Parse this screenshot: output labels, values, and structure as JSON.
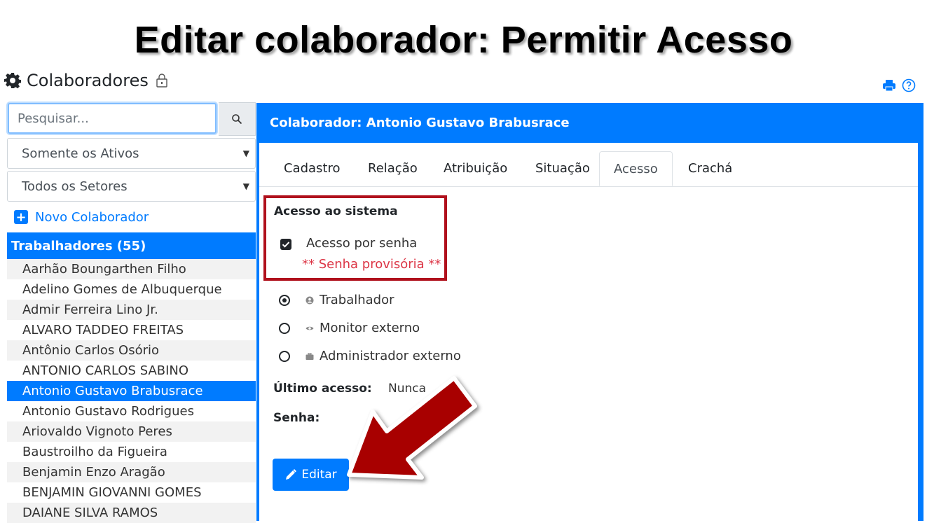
{
  "slide": {
    "title": "Editar colaborador: Permitir Acesso"
  },
  "app": {
    "title": "Colaboradores"
  },
  "search": {
    "placeholder": "Pesquisar..."
  },
  "filters": {
    "status": "Somente os Ativos",
    "sector": "Todos os Setores"
  },
  "new_link": "Novo Colaborador",
  "group_header": "Trabalhadores (55)",
  "workers": [
    "Aarhão Boungarthen Filho",
    "Adelino Gomes de Albuquerque",
    "Admir Ferreira Lino Jr.",
    "ALVARO TADDEO FREITAS",
    "Antônio Carlos Osório",
    "ANTONIO CARLOS SABINO",
    "Antonio Gustavo Brabusrace",
    "Antonio Gustavo Rodrigues",
    "Ariovaldo Vignoto Peres",
    "Baustroilho da Figueira",
    "Benjamin Enzo Aragão",
    "BENJAMIN GIOVANNI GOMES",
    "DAIANE SILVA RAMOS"
  ],
  "panel": {
    "title": "Colaborador: Antonio Gustavo Brabusrace",
    "tabs": [
      "Cadastro",
      "Relação",
      "Atribuição",
      "Situação",
      "Acesso",
      "Crachá"
    ],
    "active_tab": "Acesso",
    "access": {
      "title": "Acesso ao sistema",
      "checkbox_label": "Acesso por senha",
      "checked": true,
      "note": "** Senha provisória **"
    },
    "roles": [
      {
        "label": "Trabalhador",
        "icon": "user-circle-icon",
        "selected": true
      },
      {
        "label": "Monitor externo",
        "icon": "eye-icon",
        "selected": false
      },
      {
        "label": "Administrador externo",
        "icon": "briefcase-icon",
        "selected": false
      }
    ],
    "last_access_label": "Último acesso:",
    "last_access_value": "Nunca",
    "password_label": "Senha:",
    "edit_label": "Editar"
  },
  "colors": {
    "primary": "#007bff",
    "highlight_border": "#b0101c",
    "note": "#dc3545",
    "arrow": "#a80000"
  }
}
